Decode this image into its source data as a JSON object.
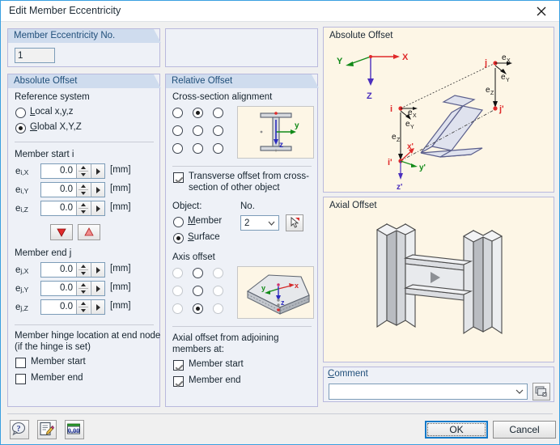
{
  "window": {
    "title": "Edit Member Eccentricity",
    "close_icon": "close-icon"
  },
  "member_no_panel": {
    "header": "Member Eccentricity No.",
    "value": "1"
  },
  "absolute_offset": {
    "header": "Absolute Offset",
    "reference_system_label": "Reference system",
    "options": [
      {
        "label": "Local x,y,z",
        "selected": false
      },
      {
        "label": "Global X,Y,Z",
        "selected": true
      }
    ],
    "member_start_label": "Member start i",
    "start_fields": [
      {
        "name": "e",
        "sub": "i,X",
        "value": "0.0",
        "unit": "[mm]"
      },
      {
        "name": "e",
        "sub": "i,Y",
        "value": "0.0",
        "unit": "[mm]"
      },
      {
        "name": "e",
        "sub": "i,Z",
        "value": "0.0",
        "unit": "[mm]"
      }
    ],
    "copy_down_icon": "triangle-down-icon",
    "copy_up_icon": "triangle-up-icon",
    "member_end_label": "Member end j",
    "end_fields": [
      {
        "name": "e",
        "sub": "j,X",
        "value": "0.0",
        "unit": "[mm]"
      },
      {
        "name": "e",
        "sub": "j,Y",
        "value": "0.0",
        "unit": "[mm]"
      },
      {
        "name": "e",
        "sub": "j,Z",
        "value": "0.0",
        "unit": "[mm]"
      }
    ],
    "hinge_label_line1": "Member hinge location at end node",
    "hinge_label_line2": "(if the hinge is set)",
    "hinge_checks": [
      {
        "label": "Member start",
        "checked": false
      },
      {
        "label": "Member end",
        "checked": false
      }
    ]
  },
  "relative_offset": {
    "header": "Relative Offset",
    "cross_section_alignment_label": "Cross-section alignment",
    "alignment_grid": [
      [
        false,
        true,
        false
      ],
      [
        false,
        false,
        false
      ],
      [
        false,
        false,
        false
      ]
    ],
    "alignment_thumb": {
      "name": "i-section-thumbnail",
      "axis_y": "y",
      "axis_z": "z"
    },
    "transverse_checkbox": {
      "line1": "Transverse offset from cross-",
      "line2": "section of other object",
      "checked": true
    },
    "object_label": "Object:",
    "no_label": "No.",
    "object_options": [
      {
        "label": "Member",
        "selected": false
      },
      {
        "label": "Surface",
        "selected": true
      }
    ],
    "object_no_value": "2",
    "pick_button_icon": "pick-cursor-icon",
    "axis_offset_label": "Axis offset",
    "axis_offset_grid": [
      [
        false,
        false,
        false
      ],
      [
        false,
        false,
        false
      ],
      [
        false,
        true,
        false
      ]
    ],
    "axis_offset_grid_enabled": [
      [
        false,
        true,
        false
      ],
      [
        false,
        true,
        false
      ],
      [
        false,
        true,
        false
      ]
    ],
    "axis_thumb": {
      "name": "surface-slab-thumbnail",
      "axis_x": "x",
      "axis_y": "y",
      "axis_z": "z"
    },
    "axial_label_line1": "Axial offset from adjoining",
    "axial_label_line2": "members at:",
    "axial_checks": [
      {
        "label": "Member start",
        "checked": true
      },
      {
        "label": "Member end",
        "checked": true
      }
    ]
  },
  "graphics": {
    "absolute": {
      "title": "Absolute Offset",
      "labels": {
        "gx": "X",
        "gy": "Y",
        "gz": "Z",
        "i": "i",
        "ip": "i'",
        "j": "j",
        "jp": "j'",
        "ex": "e",
        "ex_sub": "X",
        "ey": "e",
        "ey_sub": "Y",
        "ez": "e",
        "ez_sub": "Z",
        "lx": "x'",
        "ly": "y'",
        "lz": "z'"
      }
    },
    "axial": {
      "title": "Axial Offset",
      "play_icon": "play-triangle-icon"
    }
  },
  "comment": {
    "label": "Comment",
    "value": "",
    "placeholder": "",
    "dropdown_icon": "chevron-down-icon",
    "button_icon": "comment-library-icon"
  },
  "footer": {
    "help_icon": "help-question-icon",
    "notes_icon": "edit-note-icon",
    "units_icon": "units-number-icon",
    "ok_label": "OK",
    "cancel_label": "Cancel"
  },
  "colors": {
    "accent": "#1479c8",
    "panel_header": "#cfdcee",
    "panel_bg": "#eef1f7",
    "gfx_bg": "#fdf6e6"
  }
}
